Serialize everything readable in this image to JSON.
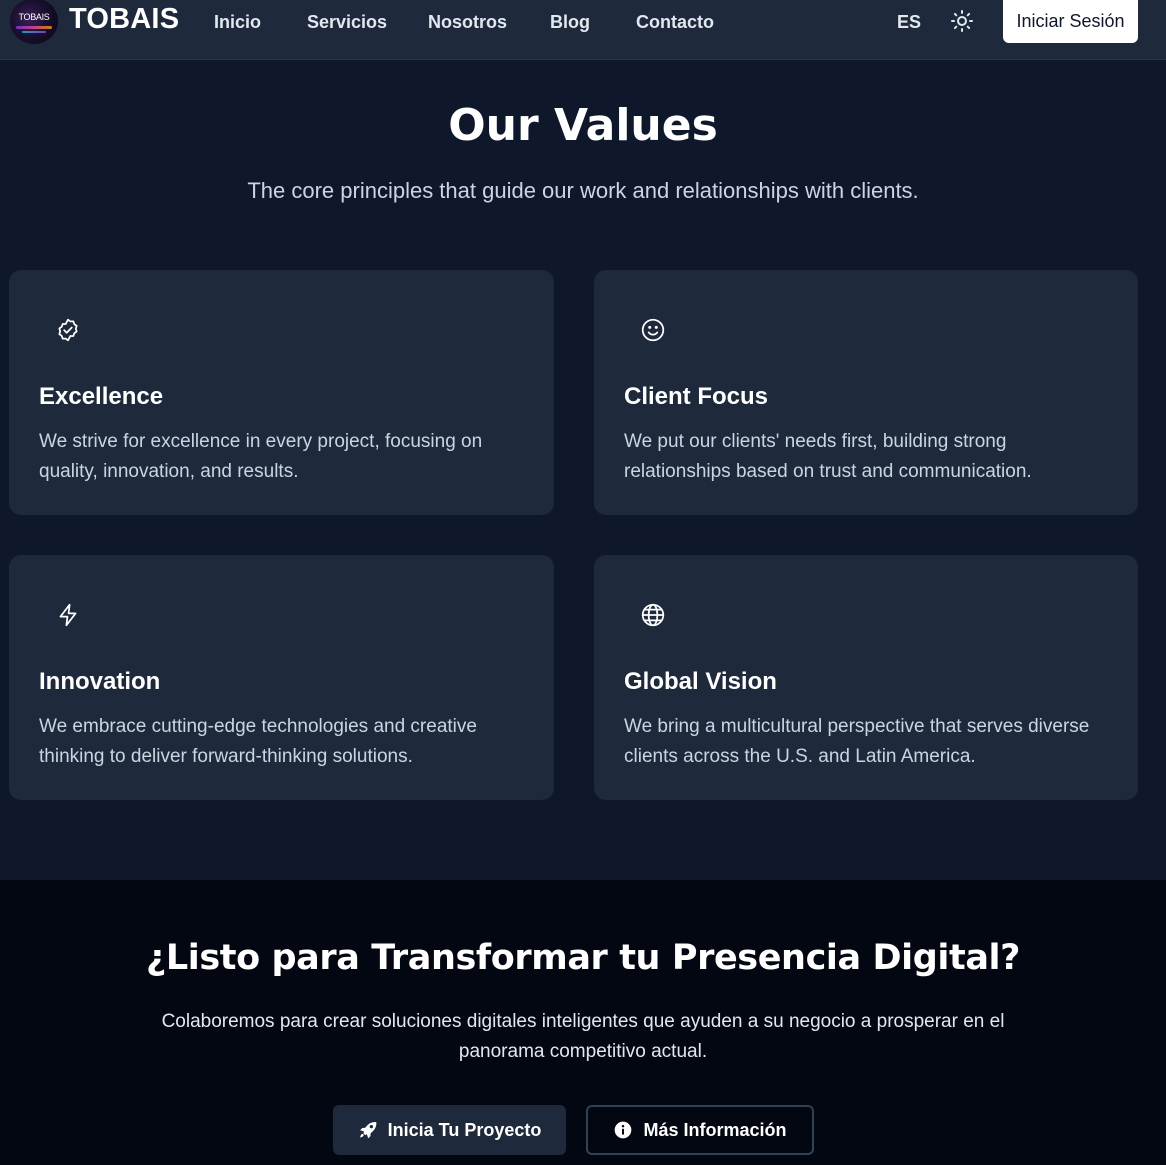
{
  "header": {
    "logo_text": "TOBAIS",
    "brand": "TOBAIS",
    "nav": [
      {
        "label": "Inicio"
      },
      {
        "label": "Servicios"
      },
      {
        "label": "Nosotros"
      },
      {
        "label": "Blog"
      },
      {
        "label": "Contacto"
      }
    ],
    "language": "ES",
    "theme_icon": "sun-icon",
    "login_label": "Iniciar Sesión"
  },
  "values": {
    "title": "Our Values",
    "subtitle": "The core principles that guide our work and relationships with clients.",
    "cards": [
      {
        "icon": "check-badge-icon",
        "title": "Excellence",
        "text": "We strive for excellence in every project, focusing on quality, innovation, and results."
      },
      {
        "icon": "smile-icon",
        "title": "Client Focus",
        "text": "We put our clients' needs first, building strong relationships based on trust and communication."
      },
      {
        "icon": "lightning-icon",
        "title": "Innovation",
        "text": "We embrace cutting-edge technologies and creative thinking to deliver forward-thinking solutions."
      },
      {
        "icon": "globe-icon",
        "title": "Global Vision",
        "text": "We bring a multicultural perspective that serves diverse clients across the U.S. and Latin America."
      }
    ]
  },
  "cta": {
    "title": "¿Listo para Transformar tu Presencia Digital?",
    "text": "Colaboremos para crear soluciones digitales inteligentes que ayuden a su negocio a prosperar en el panorama competitivo actual.",
    "primary_button": {
      "label": "Inicia Tu Proyecto",
      "icon": "rocket-icon"
    },
    "secondary_button": {
      "label": "Más Información",
      "icon": "info-icon"
    }
  },
  "colors": {
    "page_bg": "#0f172a",
    "header_bg": "#1e293b",
    "card_bg": "#1e293b",
    "cta_bg": "#030712",
    "text_primary": "#ffffff",
    "text_muted": "#cbd5e1"
  }
}
